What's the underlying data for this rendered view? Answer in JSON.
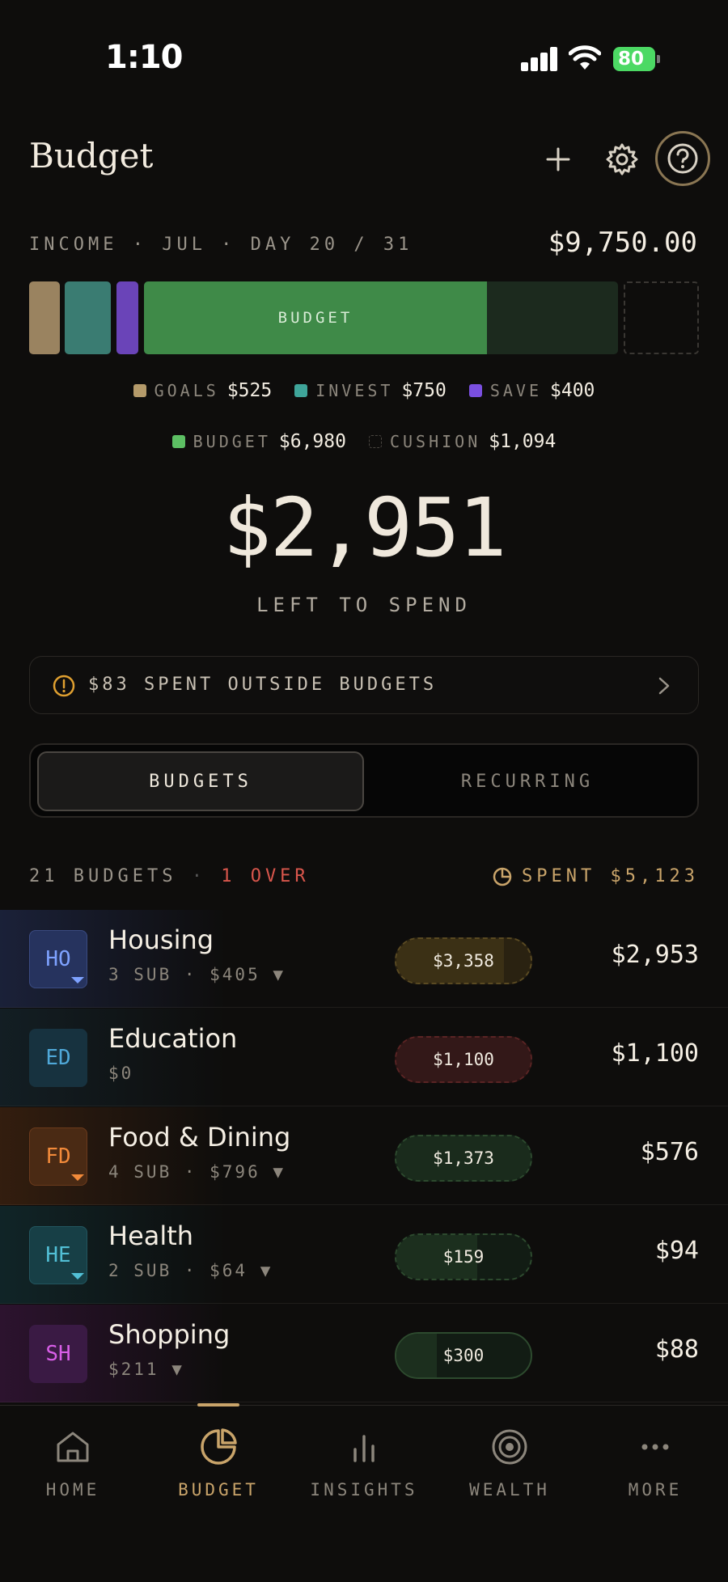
{
  "status": {
    "time": "1:10",
    "battery": "80"
  },
  "header": {
    "title": "Budget"
  },
  "income": {
    "label": "INCOME · JUL · DAY 20 / 31",
    "total": "$9,750.00"
  },
  "allocation": {
    "bar_budget_label": "BUDGET"
  },
  "legend": {
    "goals": {
      "label": "GOALS",
      "amount": "$525"
    },
    "invest": {
      "label": "INVEST",
      "amount": "$750"
    },
    "save": {
      "label": "SAVE",
      "amount": "$400"
    },
    "budget": {
      "label": "BUDGET",
      "amount": "$6,980"
    },
    "cushion": {
      "label": "CUSHION",
      "amount": "$1,094"
    }
  },
  "summary": {
    "left_amount": "$2,951",
    "left_label": "LEFT TO SPEND"
  },
  "alert": {
    "text": "$83 SPENT OUTSIDE BUDGETS"
  },
  "tabs": {
    "budgets": "BUDGETS",
    "recurring": "RECURRING"
  },
  "list": {
    "count": "21 BUDGETS",
    "dot": "·",
    "over": "1 OVER",
    "spent": "SPENT $5,123"
  },
  "colors": {
    "accent": "#c9a46a",
    "over": "#d9564c",
    "positive": "#3f8a48"
  },
  "budgets": [
    {
      "abbr": "HO",
      "name": "Housing",
      "sub": "3 SUB · $405 ▼",
      "spent": "$3,358",
      "remaining": "$2,953",
      "progress": 0.8
    },
    {
      "abbr": "ED",
      "name": "Education",
      "sub": "$0",
      "spent": "$1,100",
      "remaining": "$1,100",
      "progress": 1.0
    },
    {
      "abbr": "FD",
      "name": "Food & Dining",
      "sub": "4 SUB · $796 ▼",
      "spent": "$1,373",
      "remaining": "$576",
      "progress": 1.0
    },
    {
      "abbr": "HE",
      "name": "Health",
      "sub": "2 SUB · $64 ▼",
      "spent": "$159",
      "remaining": "$94",
      "progress": 0.6
    },
    {
      "abbr": "SH",
      "name": "Shopping",
      "sub": "$211 ▼",
      "spent": "$300",
      "remaining": "$88",
      "progress": 0.3
    }
  ],
  "nav": {
    "home": "HOME",
    "budget": "BUDGET",
    "insights": "INSIGHTS",
    "wealth": "WEALTH",
    "more": "MORE"
  }
}
